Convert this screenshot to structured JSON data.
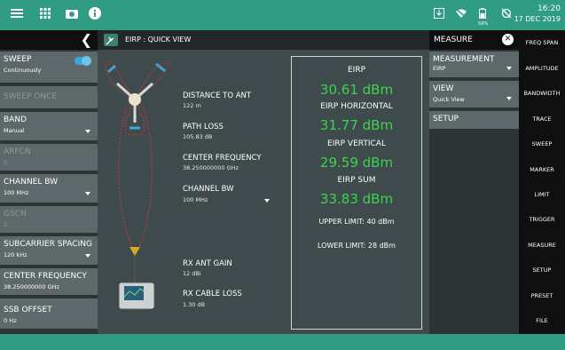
{
  "status": {
    "time": "16:20",
    "date": "17 DEC 2019",
    "battery": "59%"
  },
  "left_panel": {
    "items": [
      {
        "label": "SWEEP",
        "value": "Continuously",
        "enabled": true
      },
      {
        "label": "SWEEP ONCE",
        "value": "",
        "enabled": false
      },
      {
        "label": "BAND",
        "value": "Manual",
        "enabled": true
      },
      {
        "label": "ARFCN",
        "value": "0",
        "enabled": false
      },
      {
        "label": "CHANNEL BW",
        "value": "100 MHz",
        "enabled": true
      },
      {
        "label": "GSCN",
        "value": "2",
        "enabled": false
      },
      {
        "label": "SUBCARRIER SPACING",
        "value": "120 kHz",
        "enabled": true
      },
      {
        "label": "CENTER FREQUENCY",
        "value": "38.250000000 GHz",
        "enabled": true
      },
      {
        "label": "SSB OFFSET",
        "value": "0 Hz",
        "enabled": true
      }
    ]
  },
  "view": {
    "title": "EIRP : QUICK VIEW"
  },
  "diagram": {
    "distance_label": "DISTANCE TO ANT",
    "distance_value": "122 m",
    "path_loss_label": "PATH LOSS",
    "path_loss_value": "105.83 dB",
    "center_freq_label": "CENTER FREQUENCY",
    "center_freq_value": "38.250000000 GHz",
    "channel_bw_label": "CHANNEL BW",
    "channel_bw_value": "100 MHz",
    "rx_ant_gain_label": "RX ANT GAIN",
    "rx_ant_gain_value": "12 dBi",
    "rx_cable_loss_label": "RX CABLE LOSS",
    "rx_cable_loss_value": "1.30 dB"
  },
  "results": {
    "eirp_label": "EIRP",
    "eirp_value": "30.61 dBm",
    "eirp_h_label": "EIRP HORIZONTAL",
    "eirp_h_value": "31.77 dBm",
    "eirp_v_label": "EIRP VERTICAL",
    "eirp_v_value": "29.59 dBm",
    "eirp_sum_label": "EIRP SUM",
    "eirp_sum_value": "33.83 dBm",
    "upper_limit": "UPPER LIMIT: 40 dBm",
    "lower_limit": "LOWER LIMIT: 28 dBm",
    "value_color": "#3fd34f"
  },
  "measure_menu": {
    "title": "MEASURE",
    "items": [
      {
        "label": "MEASUREMENT",
        "value": "EIRP"
      },
      {
        "label": "VIEW",
        "value": "Quick View"
      },
      {
        "label": "SETUP",
        "value": ""
      }
    ]
  },
  "right_keys": [
    "FREQ SPAN",
    "AMPLITUDE",
    "BANDWIDTH",
    "TRACE",
    "SWEEP",
    "MARKER",
    "LIMIT",
    "TRIGGER",
    "MEASURE",
    "SETUP",
    "PRESET",
    "FILE"
  ],
  "colors": {
    "accent": "#2f9c83",
    "toggle_on": "#3ea5d6"
  }
}
